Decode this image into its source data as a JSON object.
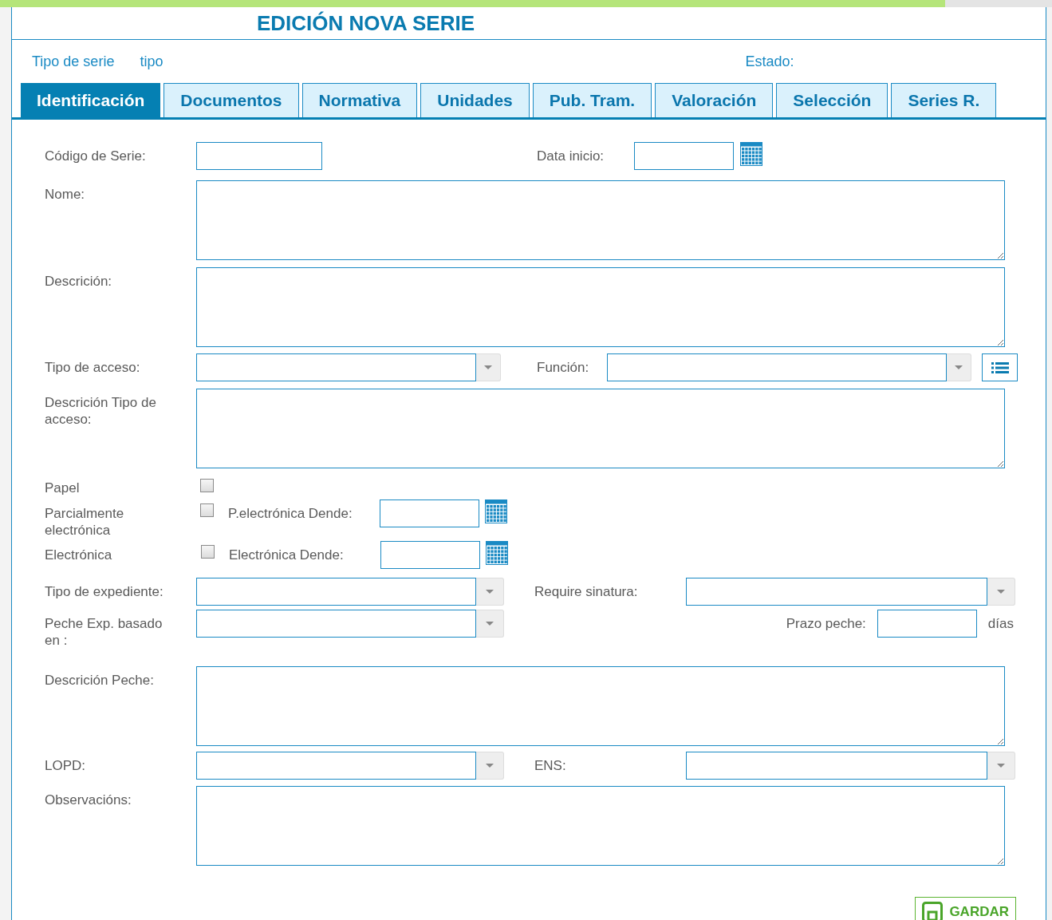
{
  "title": "EDICIÓN NOVA SERIE",
  "header": {
    "series_type_label": "Tipo de serie",
    "series_type_value": "tipo",
    "status_label": "Estado:"
  },
  "tabs": [
    {
      "label": "Identificación",
      "selected": true
    },
    {
      "label": "Documentos",
      "selected": false
    },
    {
      "label": "Normativa",
      "selected": false
    },
    {
      "label": "Unidades",
      "selected": false
    },
    {
      "label": "Pub. Tram.",
      "selected": false
    },
    {
      "label": "Valoración",
      "selected": false
    },
    {
      "label": "Selección",
      "selected": false
    },
    {
      "label": "Series R.",
      "selected": false
    }
  ],
  "form": {
    "codigo": {
      "label": "Código de Serie:"
    },
    "data_inicio": {
      "label": "Data inicio:"
    },
    "nome": {
      "label": "Nome:"
    },
    "descricion": {
      "label": "Descrición:"
    },
    "tipo_acceso": {
      "label": "Tipo de acceso:"
    },
    "funcion": {
      "label": "Función:"
    },
    "descricion_tipo_acceso": {
      "label": "Descrición Tipo de acceso:"
    },
    "papel": {
      "label": "Papel",
      "checked": false
    },
    "parcialmente": {
      "label": "Parcialmente electrónica",
      "checked": false,
      "date_label": "P.electrónica Dende:"
    },
    "electronica": {
      "label": "Electrónica",
      "checked": false,
      "date_label": "Electrónica Dende:"
    },
    "tipo_expediente": {
      "label": "Tipo de expediente:"
    },
    "require_sinatura": {
      "label": "Require sinatura:"
    },
    "peche_basado": {
      "label": "Peche Exp. basado en :"
    },
    "prazo_peche": {
      "label": "Prazo peche:",
      "unit": "días"
    },
    "descricion_peche": {
      "label": "Descrición Peche:"
    },
    "lopd": {
      "label": "LOPD:"
    },
    "ens": {
      "label": "ENS:"
    },
    "observacions": {
      "label": "Observacións:"
    }
  },
  "save_button": "GARDAR"
}
